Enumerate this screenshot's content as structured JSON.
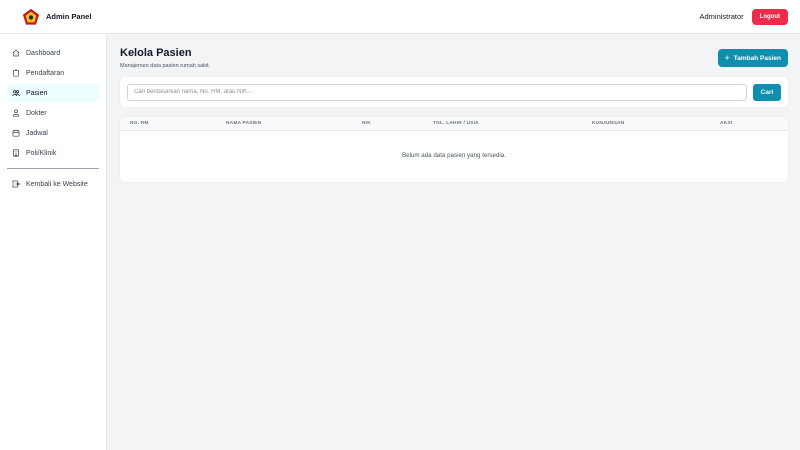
{
  "app": {
    "title": "Admin Panel",
    "user": "Administrator",
    "logout_label": "Logout",
    "accent": "#0e8fae",
    "danger": "#ef2b4c"
  },
  "sidebar": {
    "items": [
      {
        "label": "Dashboard",
        "icon": "home-icon"
      },
      {
        "label": "Pendaftaran",
        "icon": "clipboard-icon"
      },
      {
        "label": "Pasien",
        "icon": "users-icon",
        "active": true
      },
      {
        "label": "Dokter",
        "icon": "doctor-icon"
      },
      {
        "label": "Jadwal",
        "icon": "calendar-icon"
      },
      {
        "label": "Poli/Klinik",
        "icon": "building-icon"
      }
    ],
    "back_label": "Kembali ke Website"
  },
  "page": {
    "title": "Kelola Pasien",
    "subtitle": "Manajemen data pasien rumah sakit.",
    "add_label": "Tambah Pasien"
  },
  "search": {
    "placeholder": "Cari berdasarkan nama, No. RM, atau NIK...",
    "button_label": "Cari"
  },
  "table": {
    "columns": [
      "NO. RM",
      "NAMA PASIEN",
      "NIK",
      "TGL. LAHIR / USIA",
      "KUNJUNGAN",
      "AKSI"
    ],
    "empty_text": "Belum ada data pasien yang tersedia."
  }
}
